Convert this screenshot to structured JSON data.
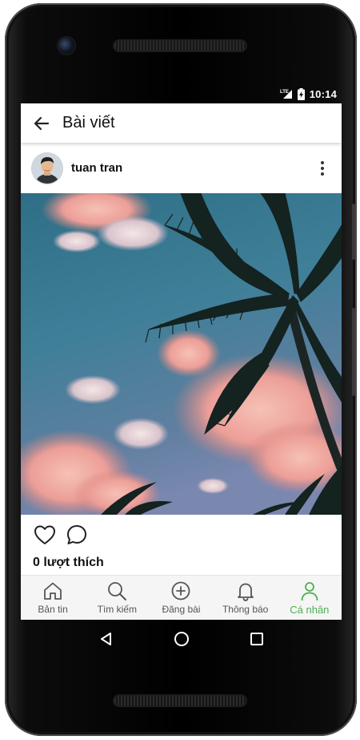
{
  "status_bar": {
    "network": "LTE",
    "time": "10:14"
  },
  "app_bar": {
    "title": "Bài viết",
    "back_icon": "arrow-left-icon"
  },
  "post": {
    "author": "tuan tran",
    "likes_text": "0 lượt thích",
    "photo_subject": "palm-trees-sky-photo",
    "like_icon": "heart-outline-icon",
    "comment_icon": "comment-bubble-icon",
    "more_icon": "more-vertical-icon"
  },
  "bottom_nav": {
    "items": [
      {
        "label": "Bản tin",
        "icon": "home-icon"
      },
      {
        "label": "Tìm kiếm",
        "icon": "search-icon"
      },
      {
        "label": "Đăng bài",
        "icon": "add-circle-icon"
      },
      {
        "label": "Thông báo",
        "icon": "bell-icon"
      },
      {
        "label": "Cá nhân",
        "icon": "person-icon"
      }
    ],
    "active_index": 4,
    "active_color": "#4caf50"
  },
  "colors": {
    "accent": "#4caf50",
    "frame": "#000000"
  }
}
